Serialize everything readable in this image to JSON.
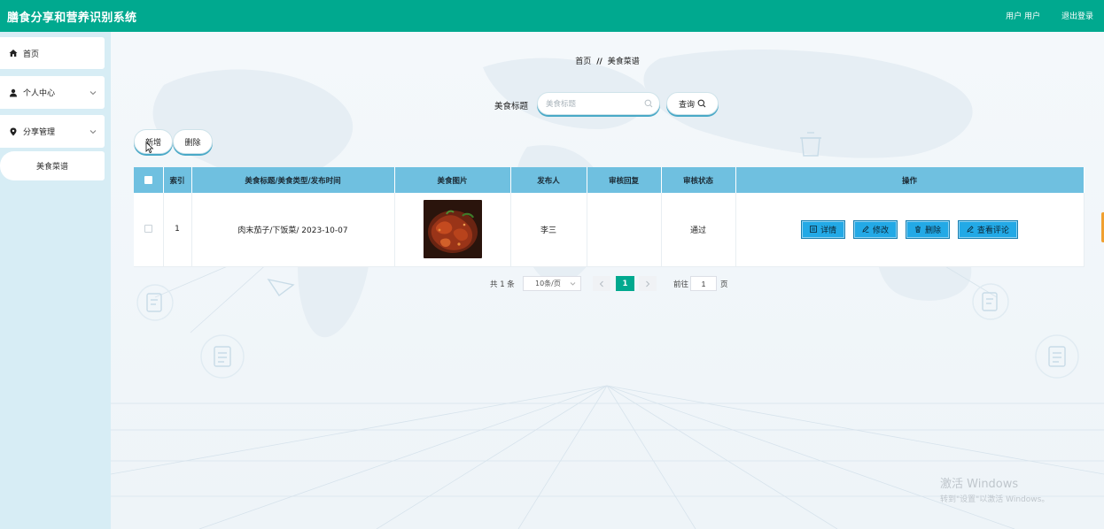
{
  "header": {
    "title": "膳食分享和营养识别系统",
    "user_label": "用户 用户",
    "logout_label": "退出登录"
  },
  "sidebar": {
    "items": [
      {
        "label": "首页",
        "icon": "home-icon"
      },
      {
        "label": "个人中心",
        "icon": "user-icon"
      },
      {
        "label": "分享管理",
        "icon": "location-icon"
      }
    ],
    "sub_items": [
      {
        "label": "美食菜谱"
      }
    ]
  },
  "breadcrumb": {
    "home": "首页",
    "separator": "//",
    "current": "美食菜谱"
  },
  "search": {
    "label": "美食标题",
    "placeholder": "美食标题",
    "value": "",
    "button_label": "查询"
  },
  "actions": {
    "add_label": "新增",
    "delete_label": "删除"
  },
  "table": {
    "headers": [
      "",
      "索引",
      "美食标题/美食类型/发布时间",
      "美食图片",
      "发布人",
      "审核回复",
      "审核状态",
      "操作"
    ],
    "rows": [
      {
        "index": "1",
        "title": "肉末茄子/下饭菜/ 2023-10-07",
        "image": "food-photo",
        "publisher": "李三",
        "review_reply": "",
        "review_status": "通过"
      }
    ],
    "row_actions": {
      "detail": "详情",
      "edit": "修改",
      "delete": "删除",
      "comments": "查看评论"
    }
  },
  "pagination": {
    "total": "共 1 条",
    "page_size": "10条/页",
    "current_page": "1",
    "goto_label": "前往",
    "goto_value": "1",
    "page_unit": "页"
  },
  "watermark": {
    "line1": "激活 Windows",
    "line2": "转到\"设置\"以激活 Windows。"
  },
  "colors": {
    "header_bg": "#00a98f",
    "sidebar_bg": "#d7edf5",
    "table_header_bg": "#6fc0e0",
    "action_button_bg": "#23a9e6",
    "page_active_bg": "#00a98f"
  }
}
